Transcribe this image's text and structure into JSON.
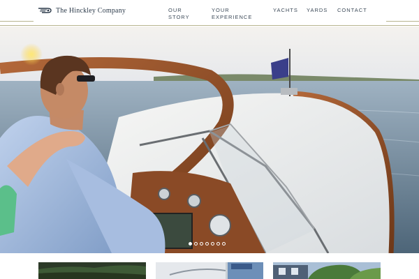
{
  "header": {
    "logo_text": "The Hinckley Company",
    "nav": [
      {
        "label": "Our Story"
      },
      {
        "label": "Your Experience"
      },
      {
        "label": "Yachts"
      },
      {
        "label": "Yards"
      },
      {
        "label": "Contact"
      }
    ]
  },
  "hero": {
    "slides_total": 7,
    "active_slide": 1
  },
  "colors": {
    "rule": "#b7b48e",
    "nav_text": "#3c4a58",
    "brand": "#2b3a4a"
  }
}
